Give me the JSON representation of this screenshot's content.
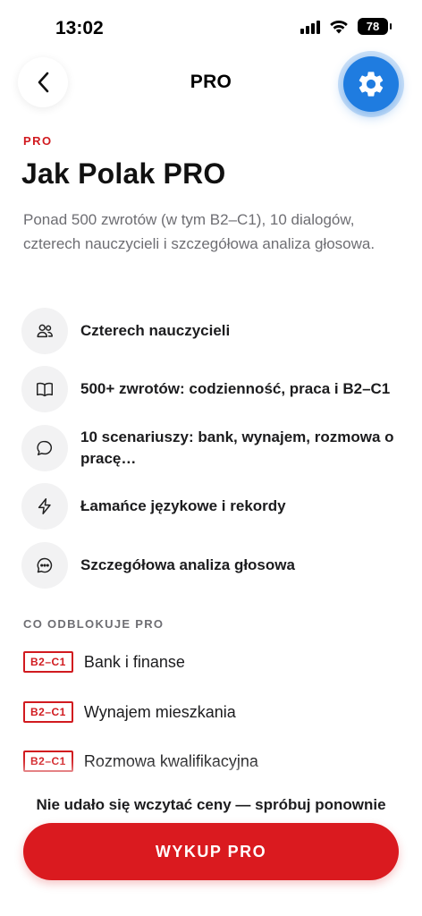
{
  "status_bar": {
    "time": "13:02",
    "battery": "78"
  },
  "header": {
    "title": "PRO"
  },
  "eyebrow": "PRO",
  "title": "Jak Polak PRO",
  "description": "Ponad 500 zwrotów (w tym B2–C1), 10 dialogów, czterech nauczycieli i szczegółowa analiza głosowa.",
  "features": [
    {
      "icon": "people-icon",
      "label": "Czterech nauczycieli"
    },
    {
      "icon": "book-icon",
      "label": "500+ zwrotów: codzienność, praca i B2–C1"
    },
    {
      "icon": "chat-bubble-icon",
      "label": "10 scenariuszy: bank, wynajem, rozmowa o pracę…"
    },
    {
      "icon": "lightning-icon",
      "label": "Łamańce językowe i rekordy"
    },
    {
      "icon": "message-dots-icon",
      "label": "Szczegółowa analiza głosowa"
    }
  ],
  "unlock_section": {
    "title": "CO ODBLOKUJE PRO",
    "items": [
      {
        "level": "B2–C1",
        "label": "Bank i finanse"
      },
      {
        "level": "B2–C1",
        "label": "Wynajem mieszkania"
      },
      {
        "level": "B2–C1",
        "label": "Rozmowa kwalifikacyjna"
      }
    ]
  },
  "bottom": {
    "error": "Nie udało się wczytać ceny — spróbuj ponownie",
    "buy_label": "WYKUP PRO"
  },
  "colors": {
    "accent": "#da1a1f",
    "settings_blue": "#1f7ce0",
    "muted": "#6e6e73"
  }
}
